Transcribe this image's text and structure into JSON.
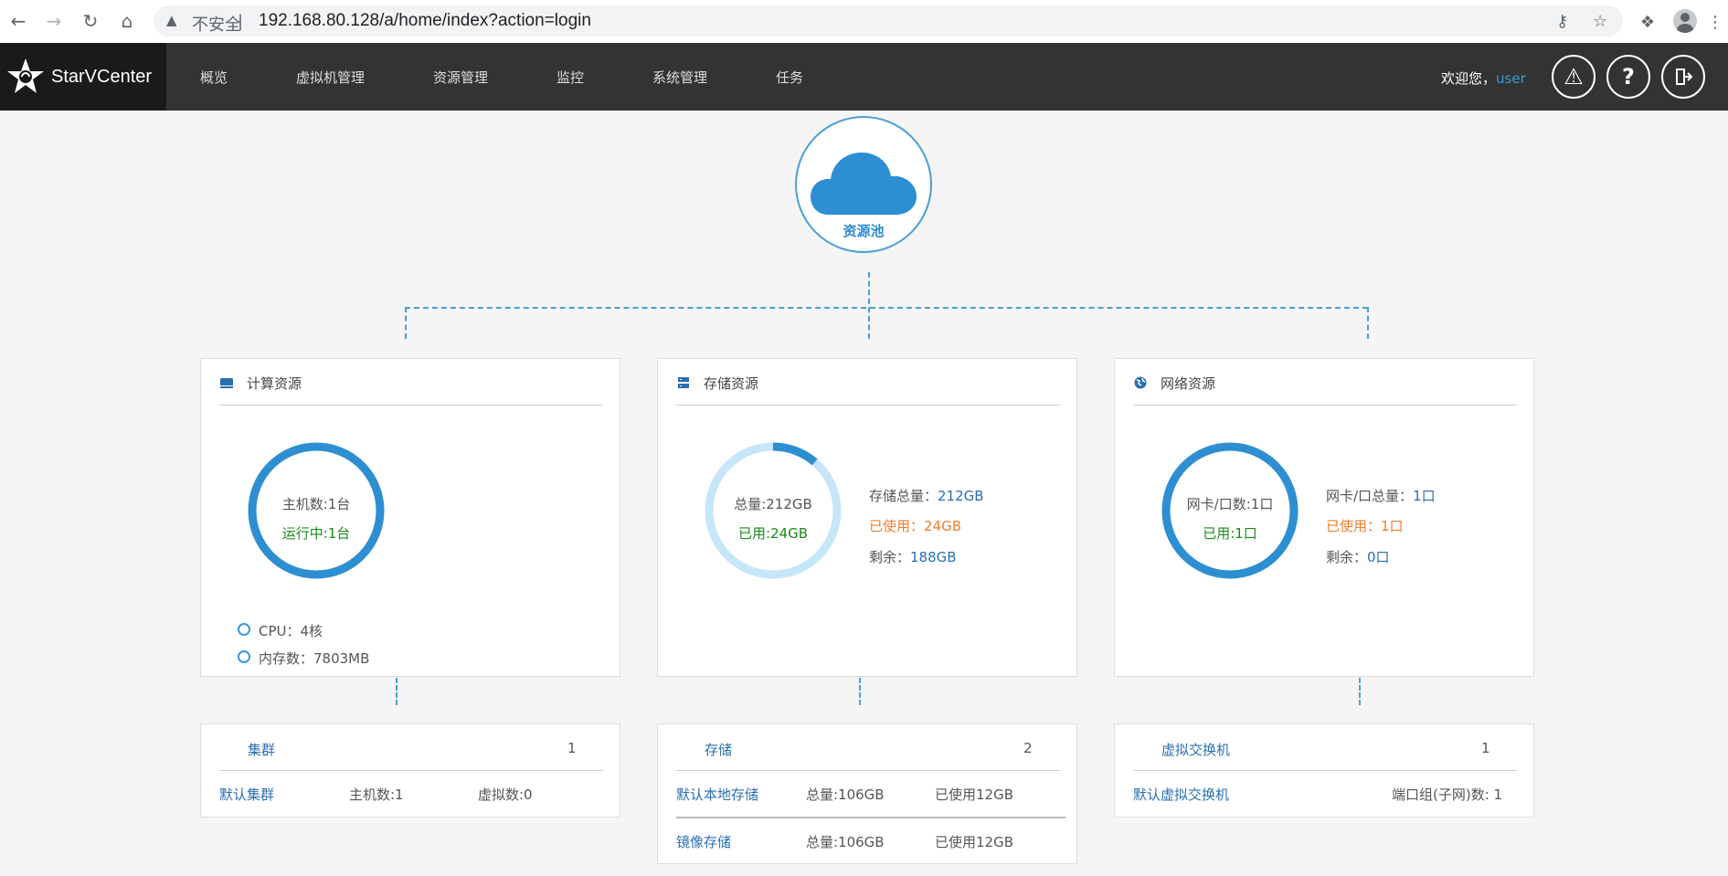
{
  "browser": {
    "insecure_label": "不安全",
    "url": "192.168.80.128/a/home/index?action=login"
  },
  "header": {
    "brand": "StarVCenter",
    "nav": [
      "概览",
      "虚拟机管理",
      "资源管理",
      "监控",
      "系统管理",
      "任务"
    ],
    "welcome": "欢迎您，",
    "username": "user"
  },
  "pool": {
    "label": "资源池"
  },
  "compute": {
    "title": "计算资源",
    "ring_line1": "主机数:1台",
    "ring_line2": "运行中:1台",
    "ring_fraction": 1.0,
    "cpu": "CPU：4核",
    "memory": "内存数：7803MB"
  },
  "storage": {
    "title": "存储资源",
    "ring_line1": "总量:212GB",
    "ring_line2": "已用:24GB",
    "ring_fraction": 0.113,
    "total_label": "存储总量：",
    "total_value": "212GB",
    "used_label": "已使用：",
    "used_value": "24GB",
    "free_label": "剩余：",
    "free_value": "188GB"
  },
  "network": {
    "title": "网络资源",
    "ring_line1": "网卡/口数:1口",
    "ring_line2": "已用:1口",
    "ring_fraction": 1.0,
    "total_label": "网卡/口总量：",
    "total_value": "1口",
    "used_label": "已使用：",
    "used_value": "1口",
    "free_label": "剩余：",
    "free_value": "0口"
  },
  "cluster_card": {
    "title": "集群",
    "count": "1",
    "row_name": "默认集群",
    "row_hosts": "主机数:1",
    "row_vms": "虚拟数:0"
  },
  "storage_card": {
    "title": "存储",
    "count": "2",
    "rows": [
      {
        "name": "默认本地存储",
        "total": "总量:106GB",
        "used": "已使用12GB"
      },
      {
        "name": "镜像存储",
        "total": "总量:106GB",
        "used": "已使用12GB"
      }
    ]
  },
  "switch_card": {
    "title": "虚拟交换机",
    "count": "1",
    "row_name": "默认虚拟交换机",
    "row_ports": "端口组(子网)数: 1"
  },
  "colors": {
    "ring_blue": "#2d8fd1",
    "ring_track": "#c6e6f9",
    "header_bg": "#333333",
    "accent": "#2a6fb0"
  }
}
